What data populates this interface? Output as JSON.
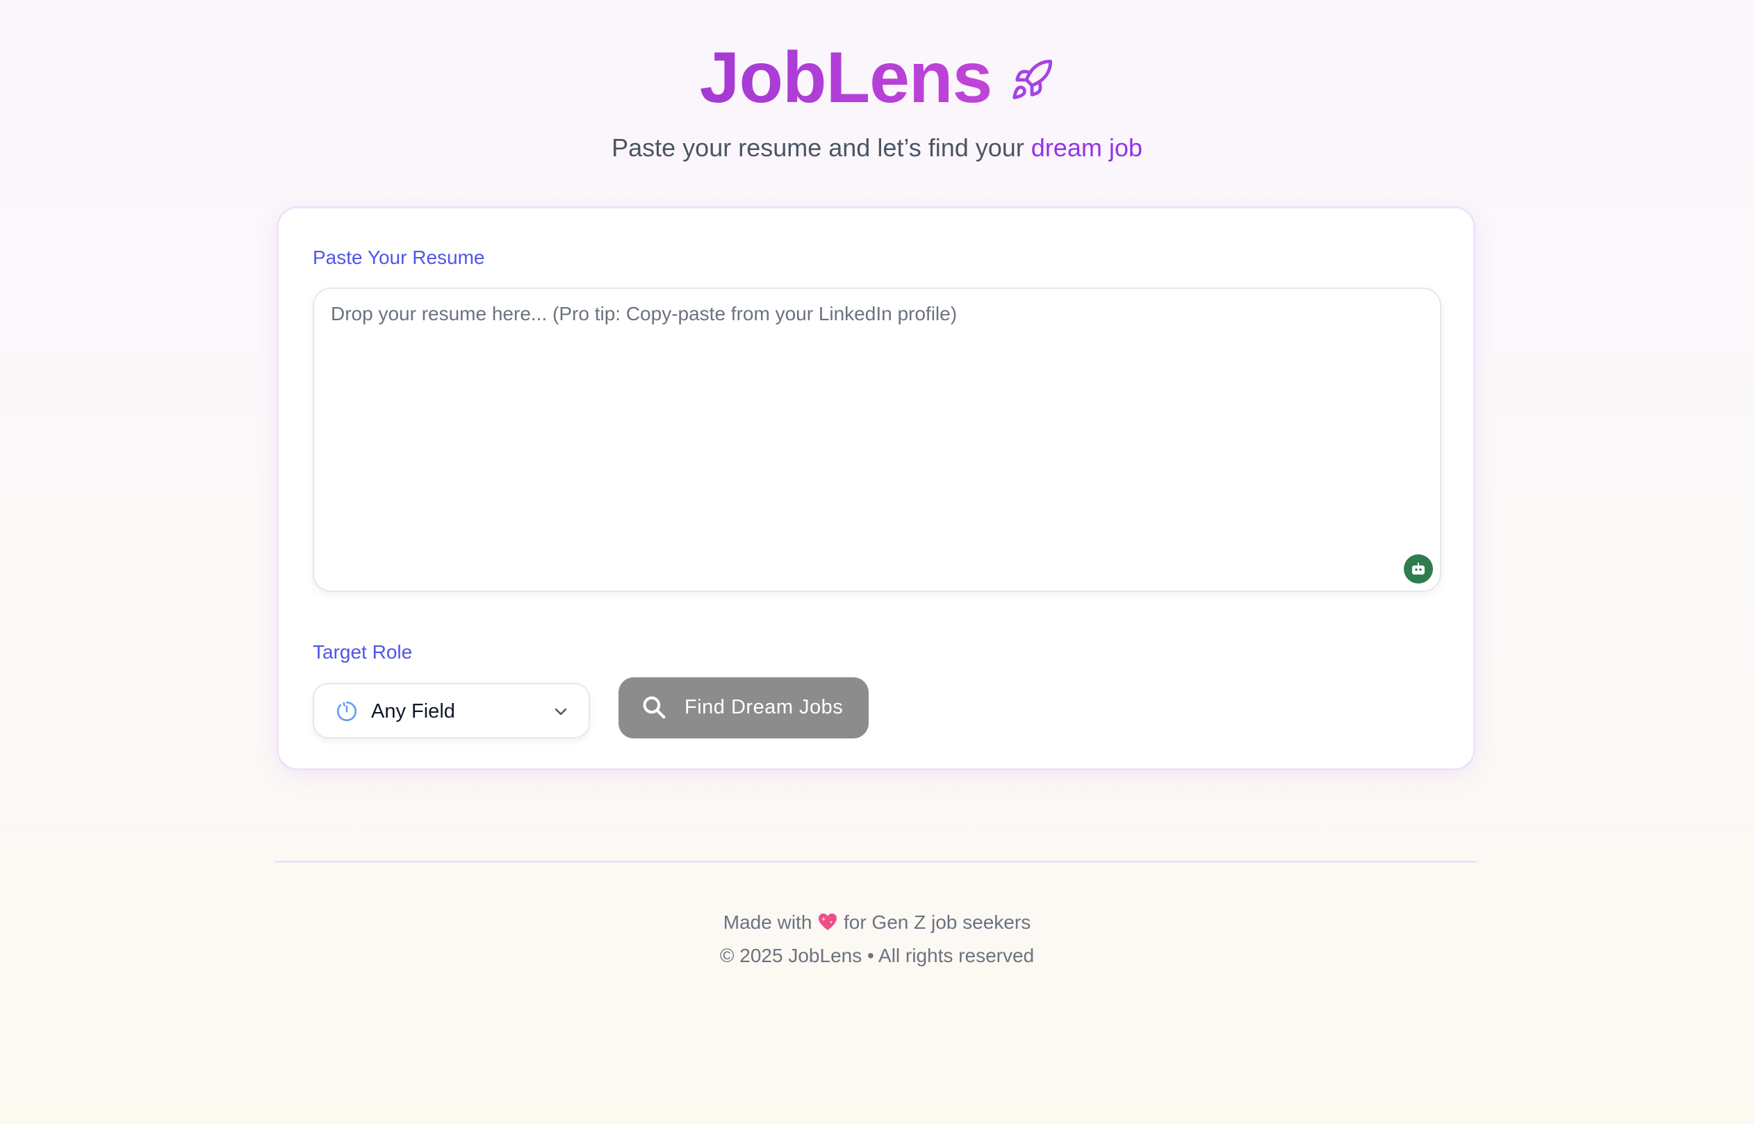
{
  "header": {
    "title": "JobLens",
    "title_icon": "rocket-icon",
    "subtitle_prefix": "Paste your resume and let’s find your ",
    "subtitle_accent": "dream job"
  },
  "form": {
    "resume_label": "Paste Your Resume",
    "resume_value": "",
    "resume_placeholder": "Drop your resume here... (Pro tip: Copy-paste from your LinkedIn profile)",
    "grammar_icon": "grammarly-icon",
    "role_label": "Target Role",
    "role_icon": "spinner-icon",
    "role_selected": "Any Field",
    "submit_label": "Find Dream Jobs",
    "submit_icon": "search-icon"
  },
  "footer": {
    "made_with_prefix": "Made with",
    "made_with_icon": "sparkling-heart-icon",
    "made_with_suffix": "for Gen Z job seekers",
    "copyright": "© 2025 JobLens • All rights reserved"
  },
  "colors": {
    "title_gradient_start": "#a43ad4",
    "title_gradient_end": "#c044d8",
    "accent": "#9333ea",
    "label": "#4f56e6",
    "button_bg": "#8c8c8c",
    "grammar_badge": "#2f7d4f"
  }
}
